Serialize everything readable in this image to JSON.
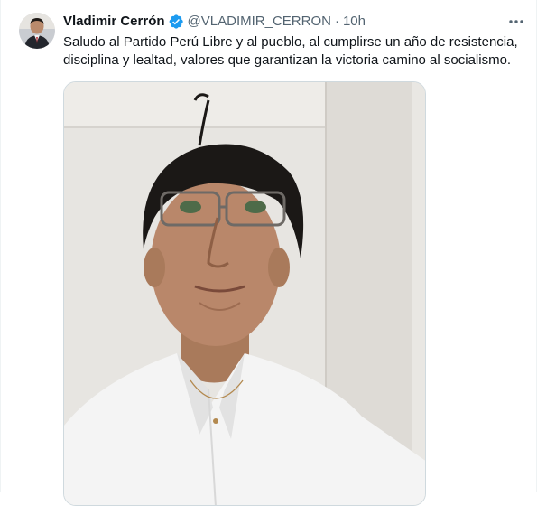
{
  "tweet": {
    "author_name": "Vladimir Cerrón",
    "handle": "@VLADIMIR_CERRON",
    "separator": "·",
    "time": "10h",
    "text": "Saludo al Partido Perú Libre y al pueblo, al cumplirse un año de resistencia,\ndisciplina y lealtad, valores que garantizan la victoria camino al socialismo."
  },
  "icons": {
    "verified": "verified-badge-icon",
    "more": "more-horizontal-icon"
  },
  "colors": {
    "verified_blue": "#1d9bf0",
    "secondary_text": "#536471",
    "primary_text": "#0f1419"
  }
}
